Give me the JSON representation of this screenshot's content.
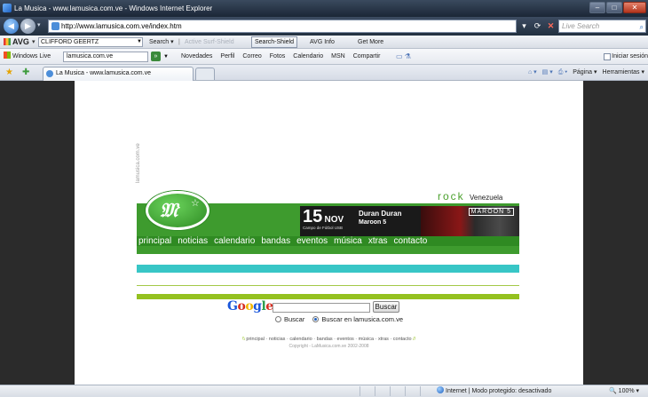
{
  "window": {
    "title": "La Musica - www.lamusica.com.ve - Windows Internet Explorer",
    "controls": {
      "minimize": "–",
      "maximize": "□",
      "close": "✕"
    }
  },
  "address_bar": {
    "url": "http://www.lamusica.com.ve/index.htm",
    "search_placeholder": "Live Search"
  },
  "avg_toolbar": {
    "brand": "AVG",
    "user": "CLIFFORD GEERTZ",
    "search": "Search",
    "active_surf": "Active Surf-Shield",
    "search_shield": "Search-Shield",
    "info": "AVG Info",
    "get_more": "Get More"
  },
  "wl_toolbar": {
    "brand": "Windows Live",
    "field_value": "lamusica.com.ve",
    "links": [
      "Novedades",
      "Perfil",
      "Correo",
      "Fotos",
      "Calendario",
      "MSN",
      "Compartir"
    ],
    "signin": "Iniciar sesión"
  },
  "tab_bar": {
    "tab_title": "La Musica - www.lamusica.com.ve",
    "commands": {
      "page": "Página",
      "tools": "Herramientas"
    }
  },
  "site": {
    "side_text": "lamusica.com.ve",
    "rock_word": "rock",
    "rock_country": "Venezuela",
    "event": {
      "day": "15",
      "month": "NOV",
      "venue": "Campo de Fútbol USB",
      "headliner": "Duran Duran",
      "support": "Maroon 5",
      "band_logo": "MAROON 5"
    },
    "nav": [
      "principal",
      "noticias",
      "calendario",
      "bandas",
      "eventos",
      "música",
      "xtras",
      "contacto"
    ],
    "search": {
      "button": "Buscar",
      "option_web": "Buscar",
      "option_site": "Buscar en lamusica.com.ve",
      "selected": "option_site"
    },
    "footer_links": "principal · noticias · calendario · bandas · eventos · música · xtras · contacto",
    "footer_prefix": "\\\\",
    "footer_suffix": "//",
    "copyright": "Copyright - LaMusica.com.ve 2002-2008"
  },
  "status_bar": {
    "zone": "Internet | Modo protegido: desactivado",
    "zoom": "100%"
  },
  "colors": {
    "site_green": "#3e9b2e",
    "nav_green": "#2f8a22",
    "cyan_bar": "#38c6c6",
    "lime_bar": "#94c11f"
  }
}
